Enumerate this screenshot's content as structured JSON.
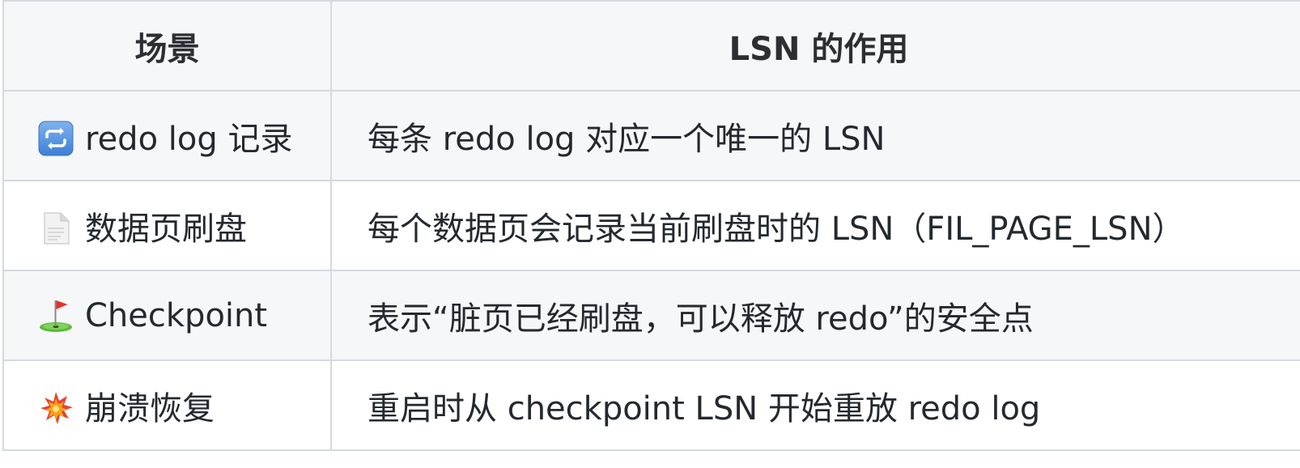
{
  "table": {
    "headers": {
      "scene": "场景",
      "lsn_role": "LSN 的作用"
    },
    "rows": [
      {
        "icon": "repeat-arrows-icon",
        "scene": "redo log 记录",
        "role": "每条 redo log 对应一个唯一的 LSN"
      },
      {
        "icon": "document-page-icon",
        "scene": "数据页刷盘",
        "role": "每个数据页会记录当前刷盘时的 LSN（FIL_PAGE_LSN）"
      },
      {
        "icon": "golf-flag-icon",
        "scene": "Checkpoint",
        "role": "表示“脏页已经刷盘，可以释放 redo”的安全点"
      },
      {
        "icon": "collision-burst-icon",
        "scene": "崩溃恢复",
        "role": "重启时从 checkpoint LSN 开始重放 redo log"
      }
    ]
  },
  "colors": {
    "border": "#d5d9e0",
    "header_bg": "#f6f7f9",
    "stripe_bg": "#f6f7f9",
    "text": "#24292f"
  }
}
